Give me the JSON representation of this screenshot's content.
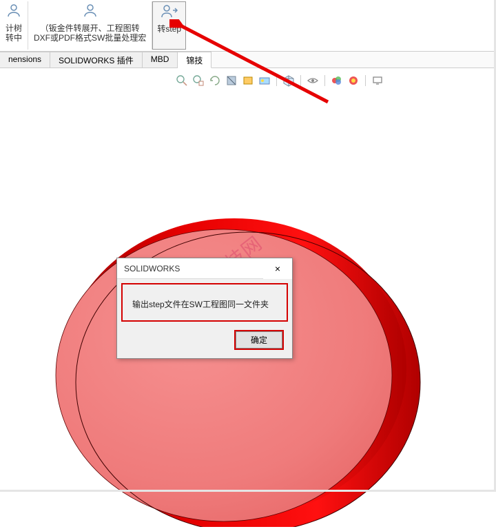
{
  "ribbon": {
    "group1": {
      "label": "计树\n转中",
      "icon": "user-icon"
    },
    "group2": {
      "label": "（钣金件转展开、工程图转\nDXF或PDF格式SW批量处理宏",
      "icon": "user-icon"
    },
    "group3": {
      "label": "转step",
      "icon": "user-arrow-icon"
    }
  },
  "tabs": {
    "t1": "nensions",
    "t2": "SOLIDWORKS 插件",
    "t3": "MBD",
    "t4": "锦技"
  },
  "toolbar": {
    "i1": "zoom-icon",
    "i2": "pan-icon",
    "i3": "rotate-icon",
    "i4": "section-icon",
    "i5": "display-icon",
    "i6": "scene-icon",
    "i7": "box-icon",
    "i8": "eye-icon",
    "i9": "appearance-icon",
    "i10": "decal-icon",
    "i11": "monitor-icon"
  },
  "dialog": {
    "title": "SOLIDWORKS",
    "message": "输出step文件在SW工程图同一文件夹",
    "ok": "确定",
    "close": "×"
  },
  "watermark": "锦技网"
}
